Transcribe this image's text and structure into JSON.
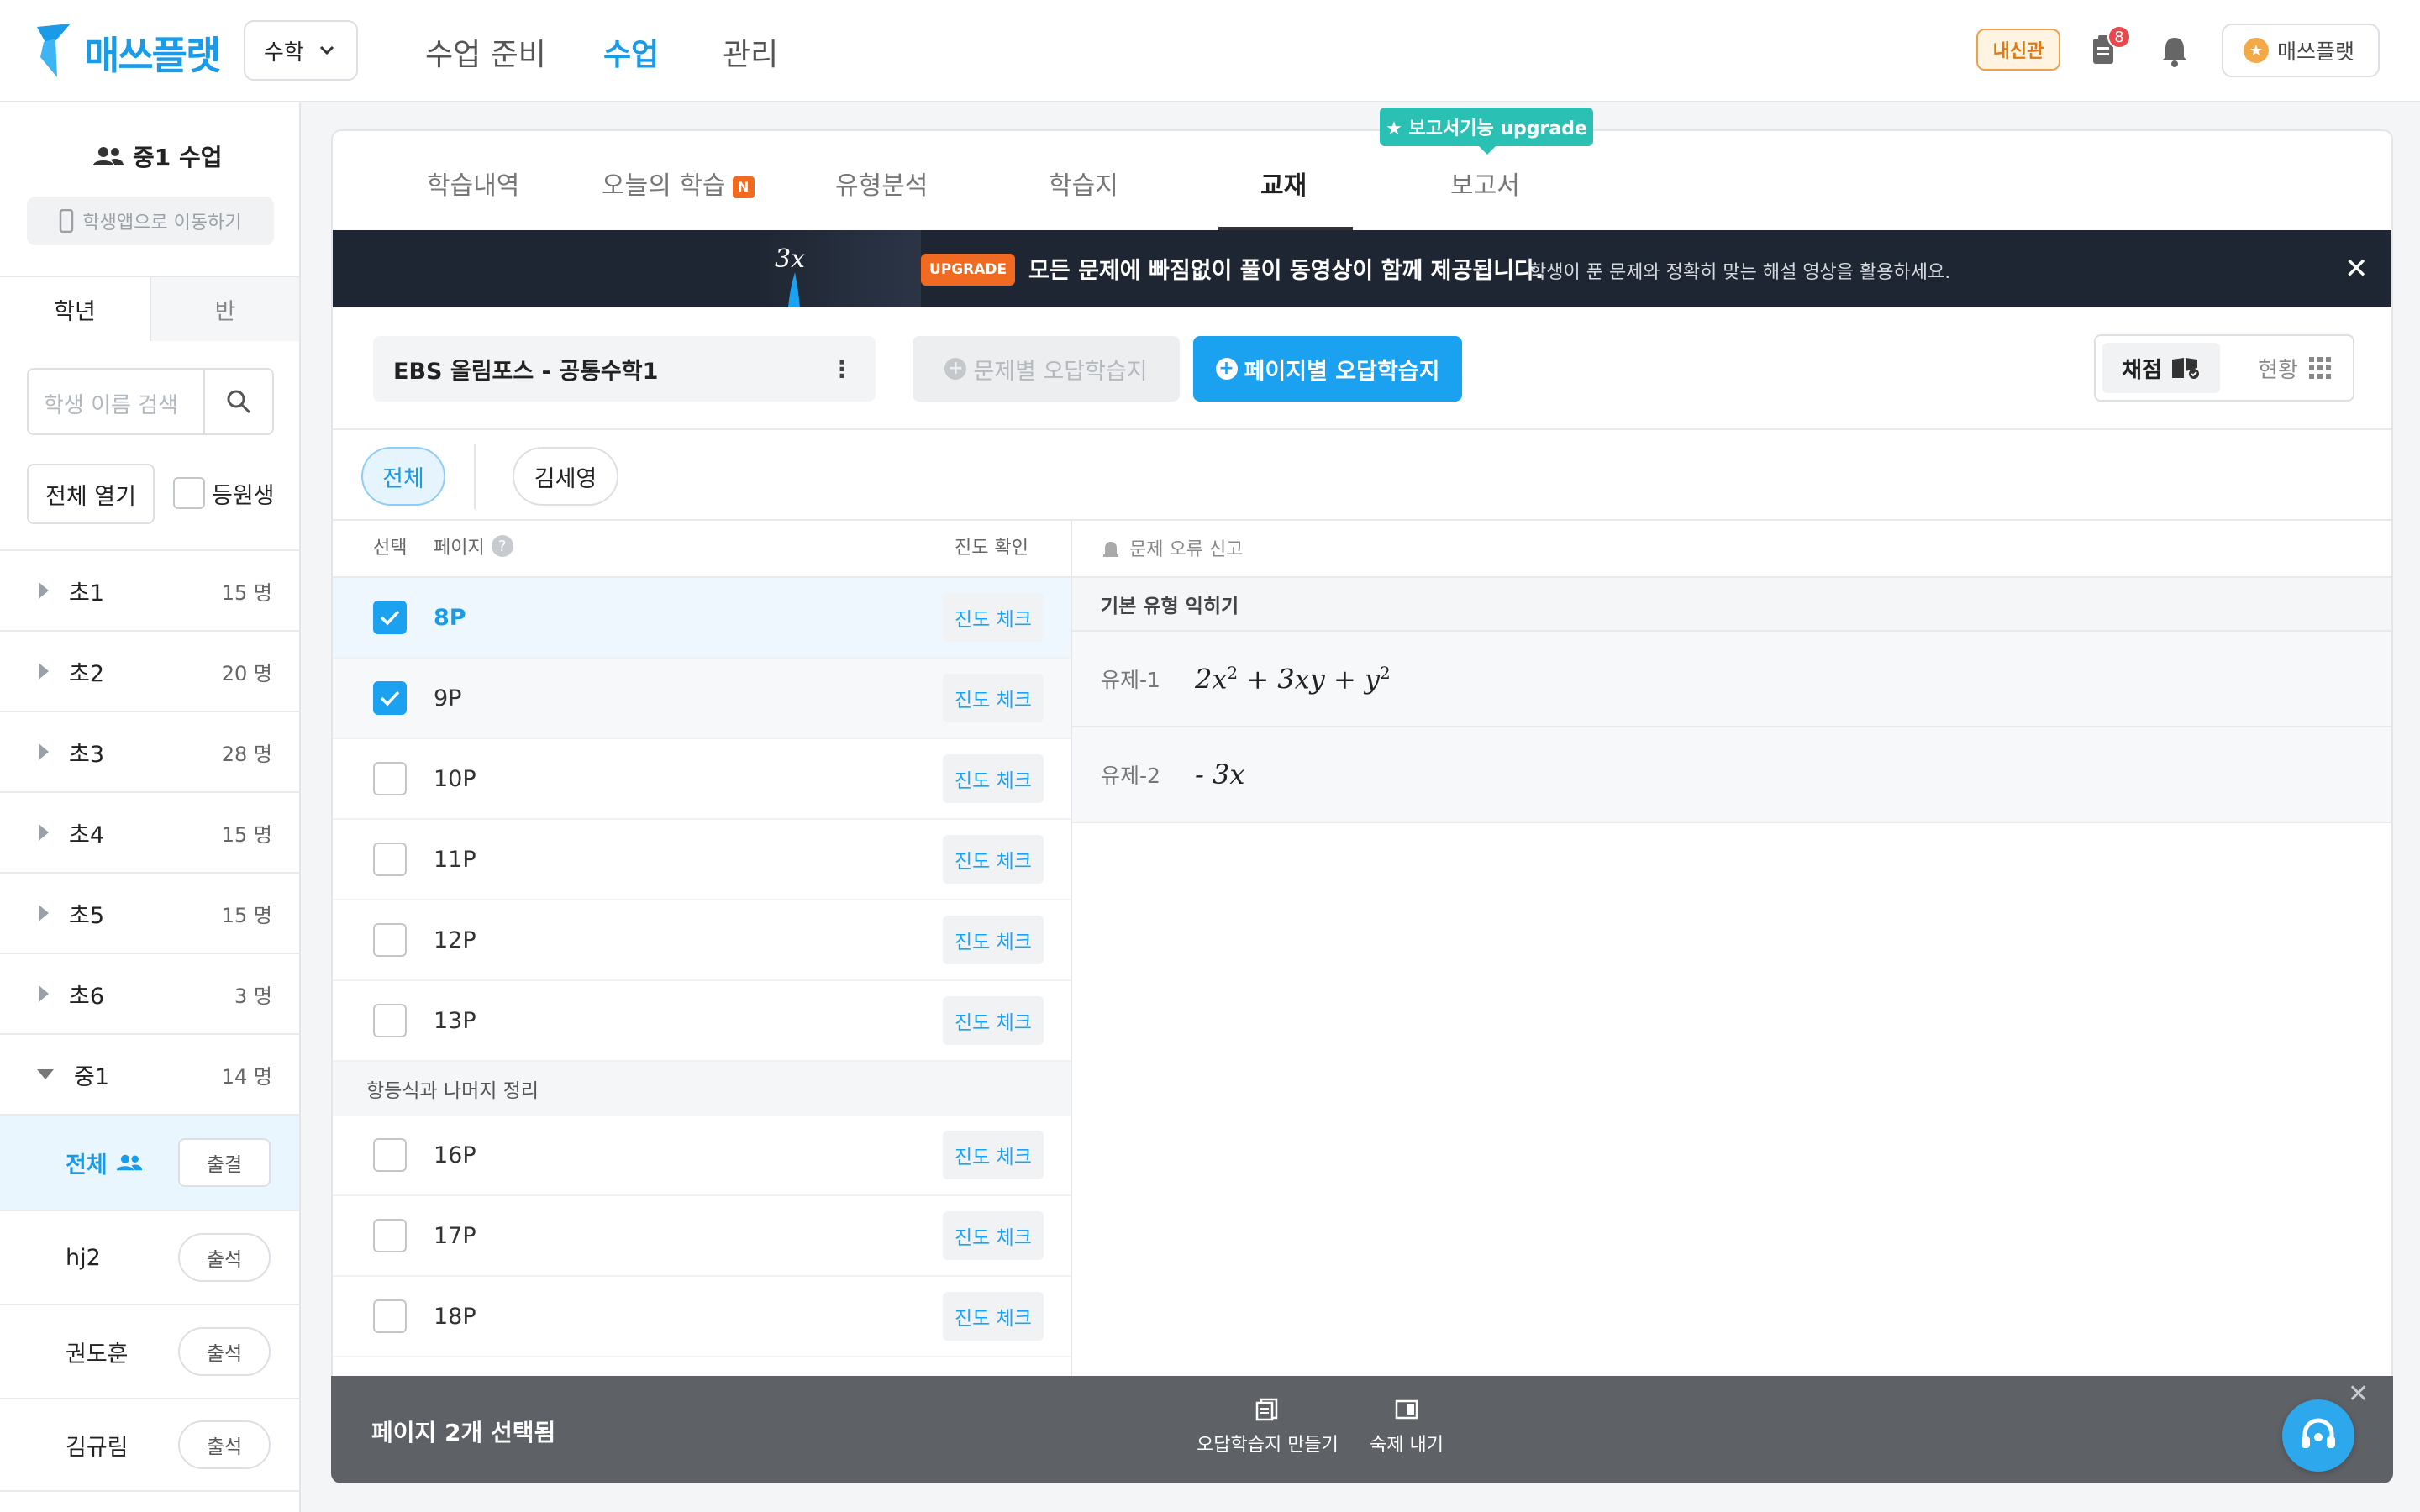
{
  "app": {
    "name": "매쓰플랫",
    "subject": "수학"
  },
  "nav": [
    "수업 준비",
    "수업",
    "관리"
  ],
  "header": {
    "naesin": "내신관",
    "notif_count": "8",
    "user": "매쓰플랫"
  },
  "sidebar": {
    "class_title": "중1 수업",
    "student_app": "학생앱으로 이동하기",
    "tabs": [
      "학년",
      "반"
    ],
    "search_placeholder": "학생 이름 검색",
    "expand_all": "전체 열기",
    "enrolled": "등원생",
    "grades": [
      {
        "name": "초1",
        "count": "15 명"
      },
      {
        "name": "초2",
        "count": "20 명"
      },
      {
        "name": "초3",
        "count": "28 명"
      },
      {
        "name": "초4",
        "count": "15 명"
      },
      {
        "name": "초5",
        "count": "15 명"
      },
      {
        "name": "초6",
        "count": "3 명"
      },
      {
        "name": "중1",
        "count": "14 명"
      }
    ],
    "all_label": "전체",
    "all_btn": "출결",
    "students": [
      {
        "name": "hj2",
        "btn": "출석"
      },
      {
        "name": "권도훈",
        "btn": "출석"
      },
      {
        "name": "김규림",
        "btn": "출석"
      }
    ]
  },
  "main": {
    "tabs": [
      "학습내역",
      "오늘의 학습",
      "유형분석",
      "학습지",
      "교재",
      "보고서"
    ],
    "new_badge": "N",
    "upgrade_tip": "★ 보고서기능 upgrade",
    "banner": {
      "tag": "UPGRADE",
      "main": "모든 문제에 빠짐없이 풀이 동영상이 함께 제공됩니다.",
      "sub": "학생이 푼 문제와 정확히 맞는 해설 영상을 활용하세요.",
      "img_text": "3x"
    },
    "book": "EBS 올림포스 - 공통수학1",
    "btn_per_problem": "문제별 오답학습지",
    "btn_per_page": "페이지별 오답학습지",
    "seg_grade": "채점",
    "seg_status": "현황",
    "chips": [
      "전체",
      "김세영"
    ],
    "col_select": "선택",
    "col_page": "페이지",
    "col_progress": "진도 확인",
    "progress_btn": "진도 체크",
    "pages_top": [
      "8P",
      "9P",
      "10P",
      "11P",
      "12P",
      "13P"
    ],
    "section2": "항등식과 나머지 정리",
    "pages_bottom": [
      "16P",
      "17P",
      "18P"
    ],
    "error_report": "문제 오류 신고",
    "right_section": "기본 유형 익히기",
    "problems": [
      {
        "label": "유제-1"
      },
      {
        "label": "유제-2"
      }
    ]
  },
  "bottom": {
    "selected": "페이지 2개 선택됨",
    "make_sheet": "오답학습지 만들기",
    "homework": "숙제 내기"
  }
}
